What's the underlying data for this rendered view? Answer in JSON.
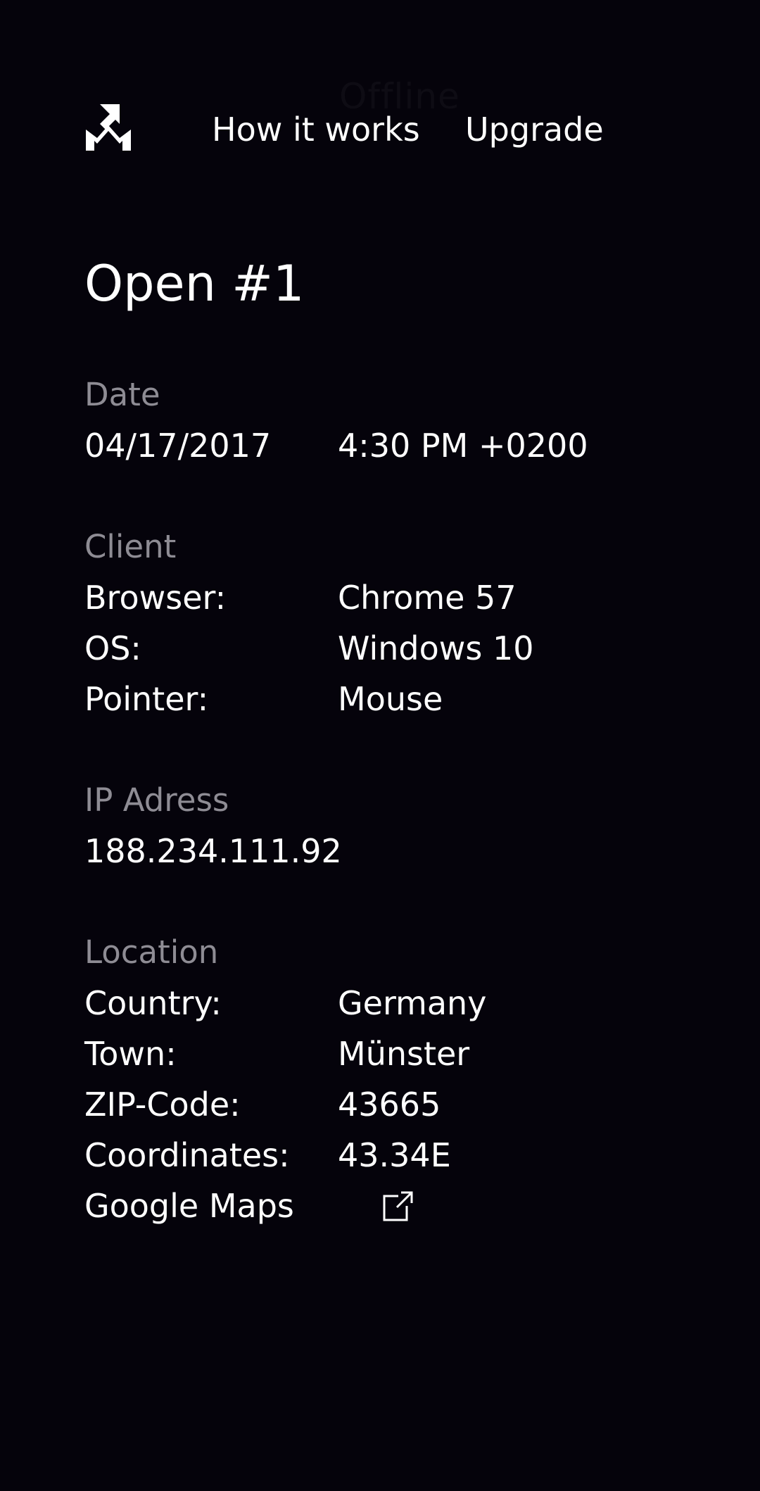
{
  "status_text": "Offline",
  "header": {
    "logo_icon": "logo-mark-icon",
    "nav": [
      {
        "label": "How it works"
      },
      {
        "label": "Upgrade"
      }
    ]
  },
  "page": {
    "title": "Open #1"
  },
  "date": {
    "label": "Date",
    "day": "04/17/2017",
    "time": "4:30 PM +0200"
  },
  "client": {
    "label": "Client",
    "browser": {
      "key": "Browser:",
      "value": "Chrome 57"
    },
    "os": {
      "key": "OS:",
      "value": "Windows 10"
    },
    "pointer": {
      "key": "Pointer:",
      "value": "Mouse"
    }
  },
  "ip": {
    "label": "IP Adress",
    "value": "188.234.111.92"
  },
  "location": {
    "label": "Location",
    "country": {
      "key": "Country:",
      "value": "Germany"
    },
    "town": {
      "key": "Town:",
      "value": "Münster"
    },
    "zip": {
      "key": "ZIP-Code:",
      "value": "43665"
    },
    "coordinates": {
      "key": "Coordinates:",
      "value": "43.34E"
    },
    "maps": {
      "label": "Google Maps",
      "icon": "external-link-icon"
    }
  },
  "colors": {
    "background": "#05030b",
    "text": "#ffffff",
    "label_gray": "#8e8c94"
  }
}
